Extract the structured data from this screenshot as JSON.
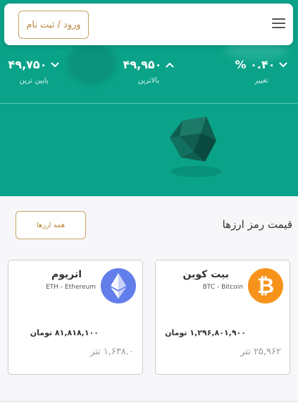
{
  "header": {
    "login_label": "ورود / ثبت نام"
  },
  "stats": [
    {
      "value": "۴۹,۷۵۰",
      "label": "پایین ترین",
      "direction": "down"
    },
    {
      "value": "۴۹,۹۵۰",
      "label": "بالاترین",
      "direction": "up"
    },
    {
      "value": "% ۰.۴۰",
      "label": "تغییر",
      "direction": "down"
    }
  ],
  "prices": {
    "title": "قیمت رمز ارزها",
    "all_label": "همه ارزها",
    "coins": [
      {
        "name": "بیت کوین",
        "symbol": "BTC - Bitcoin",
        "toman": "۱,۲۹۶,۸۰۱,۹۰۰ تومان",
        "tether": "۲۵,۹۶۲ تتر",
        "color": "#f7931a"
      },
      {
        "name": "اتریوم",
        "symbol": "ETH - Ethereum",
        "toman": "۸۱,۸۱۸,۱۰۰ تومان",
        "tether": "۱,۶۳۸.۰ تتر",
        "color": "#627eea"
      }
    ]
  },
  "colors": {
    "hero": "#0aa389",
    "accent": "#c8a165"
  }
}
